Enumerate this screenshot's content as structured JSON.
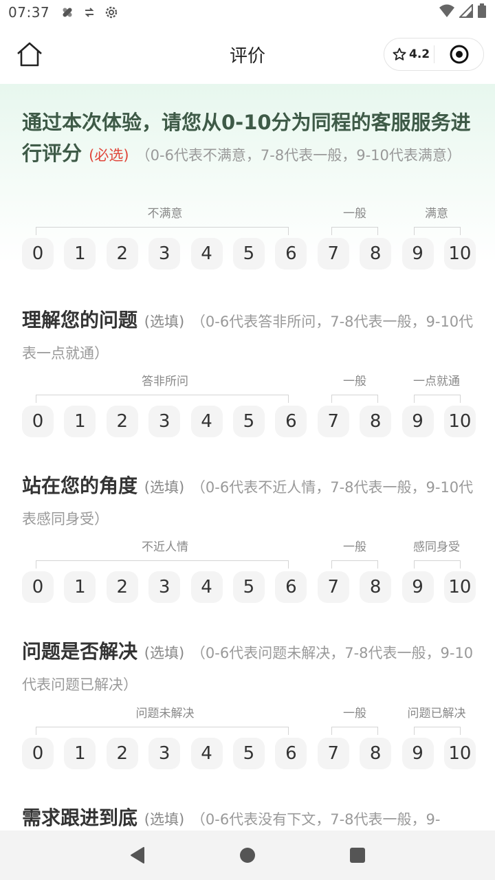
{
  "status": {
    "time": "07:37"
  },
  "nav": {
    "title": "评价",
    "rating": "4.2"
  },
  "scores": [
    "0",
    "1",
    "2",
    "3",
    "4",
    "5",
    "6",
    "7",
    "8",
    "9",
    "10"
  ],
  "questions": [
    {
      "title": "通过本次体验，请您从0-10分为同程的客服服务进行评分",
      "tag": "(必选)",
      "hint": "（0-6代表不满意，7-8代表一般，9-10代表满意）",
      "labels": {
        "low": "不满意",
        "mid": "一般",
        "high": "满意"
      }
    },
    {
      "title": "理解您的问题",
      "tag": "(选填)",
      "hint": "（0-6代表答非所问，7-8代表一般，9-10代表一点就通）",
      "labels": {
        "low": "答非所问",
        "mid": "一般",
        "high": "一点就通"
      }
    },
    {
      "title": "站在您的角度",
      "tag": "(选填)",
      "hint": "（0-6代表不近人情，7-8代表一般，9-10代表感同身受）",
      "labels": {
        "low": "不近人情",
        "mid": "一般",
        "high": "感同身受"
      }
    },
    {
      "title": "问题是否解决",
      "tag": "(选填)",
      "hint": "（0-6代表问题未解决，7-8代表一般，9-10代表问题已解决）",
      "labels": {
        "low": "问题未解决",
        "mid": "一般",
        "high": "问题已解决"
      }
    },
    {
      "title": "需求跟进到底",
      "tag": "(选填)",
      "hint": "（0-6代表没有下文，7-8代表一般，9-"
    }
  ]
}
